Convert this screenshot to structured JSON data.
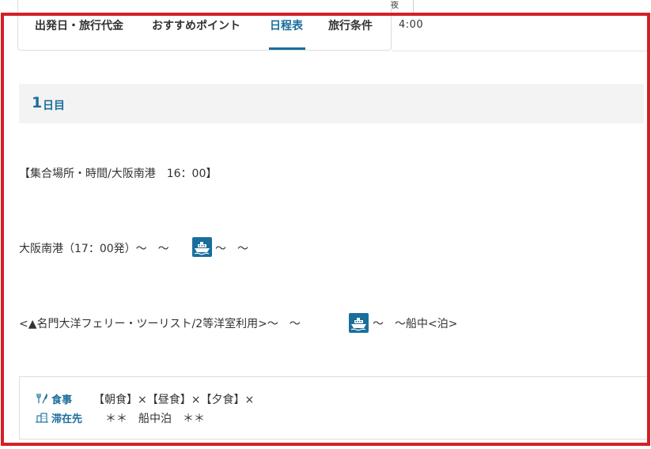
{
  "tabs": [
    {
      "label": "出発日・旅行代金",
      "active": false
    },
    {
      "label": "おすすめポイント",
      "active": false
    },
    {
      "label": "日程表",
      "active": true
    },
    {
      "label": "旅行条件",
      "active": false
    }
  ],
  "side": {
    "cut_char": "夜",
    "time": "4:00"
  },
  "day": {
    "number": "1",
    "suffix": "日目"
  },
  "itinerary": {
    "assembly": "【集合場所・時間/大阪南港　16：00】",
    "route1_before": "大阪南港（17：00発）～　～",
    "route1_after": "～　～",
    "route2_before": "<▲名門大洋フェリー・ツーリスト/2等洋室利用>～　～",
    "route2_after": "～　～船中<泊>"
  },
  "details": {
    "meal_label": "食事",
    "meal_value": "【朝食】×【昼食】×【夕食】×",
    "stay_label": "滞在先",
    "stay_value": "＊＊　船中泊　＊＊"
  },
  "icons": {
    "ferry": "ferry-icon",
    "meal": "fork-knife-icon",
    "stay": "building-icon"
  },
  "colors": {
    "accent": "#1a6e9b",
    "highlight_frame": "#d42027",
    "day_band": "#f3f3f3"
  }
}
